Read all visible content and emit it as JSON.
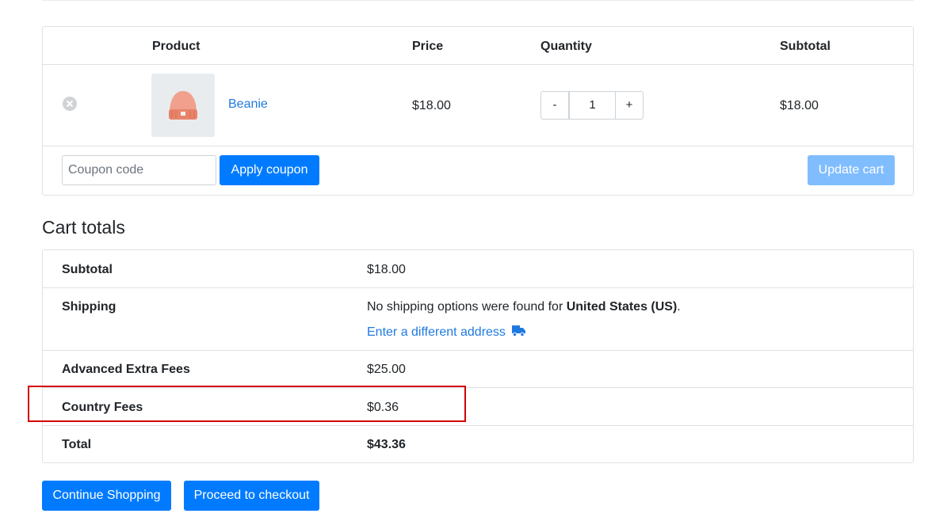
{
  "cart": {
    "headers": {
      "product": "Product",
      "price": "Price",
      "quantity": "Quantity",
      "subtotal": "Subtotal"
    },
    "items": [
      {
        "name": "Beanie",
        "price": "$18.00",
        "quantity": "1",
        "subtotal": "$18.00",
        "minus_label": "-",
        "plus_label": "+"
      }
    ],
    "coupon_placeholder": "Coupon code",
    "apply_coupon_label": "Apply coupon",
    "update_cart_label": "Update cart"
  },
  "totals": {
    "heading": "Cart totals",
    "subtotal_label": "Subtotal",
    "subtotal_value": "$18.00",
    "shipping_label": "Shipping",
    "shipping_text": "No shipping options were found for ",
    "shipping_country": "United States (US)",
    "shipping_text_end": ".",
    "different_address_label": "Enter a different address",
    "fees": [
      {
        "label": "Advanced Extra Fees",
        "value": "$25.00"
      },
      {
        "label": "Country Fees",
        "value": "$0.36"
      }
    ],
    "total_label": "Total",
    "total_value": "$43.36"
  },
  "actions": {
    "continue_label": "Continue Shopping",
    "checkout_label": "Proceed to checkout"
  },
  "colors": {
    "primary": "#007bff",
    "primary_disabled": "#80bdff",
    "link": "#1f7ae0",
    "highlight": "#d40000"
  }
}
